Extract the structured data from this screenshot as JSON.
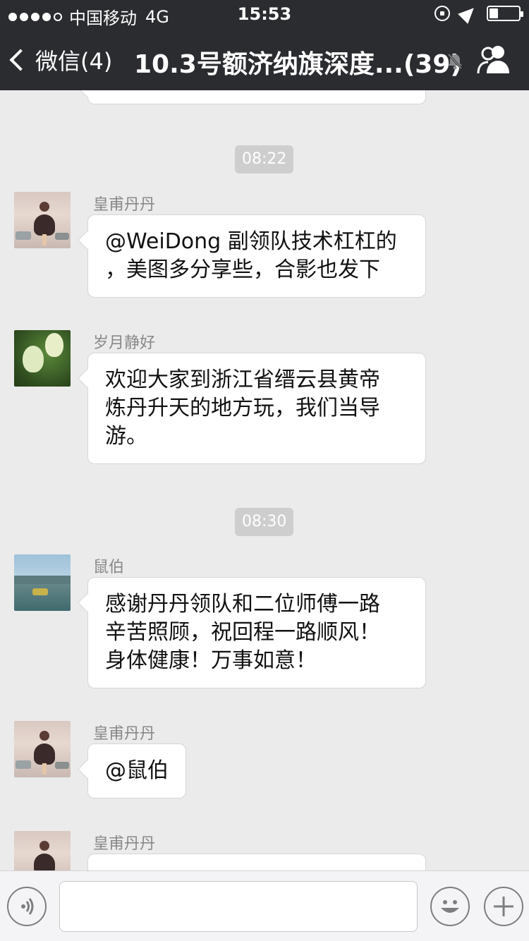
{
  "status_bar": {
    "carrier": "中国移动",
    "network": "4G",
    "time": "15:53"
  },
  "nav": {
    "back_label": "微信(4)",
    "title": "10.3号额济纳旗深度...(39)"
  },
  "messages": [
    {
      "type": "time",
      "text": "08:22"
    },
    {
      "type": "msg",
      "name": "皇甫丹丹",
      "lines": [
        "@WeiDong 副领队技术杠杠的",
        "，美图多分享些，合影也发下"
      ]
    },
    {
      "type": "msg",
      "name": "岁月静好",
      "lines": [
        "欢迎大家到浙江省缙云县黄帝",
        "炼丹升天的地方玩，我们当导",
        "游。"
      ]
    },
    {
      "type": "time",
      "text": "08:30"
    },
    {
      "type": "msg",
      "name": "鼠伯",
      "lines": [
        "感谢丹丹领队和二位师傅一路",
        "辛苦照顾，祝回程一路顺风！",
        "身体健康！万事如意！"
      ]
    },
    {
      "type": "msg",
      "name": "皇甫丹丹",
      "lines": [
        "@鼠伯"
      ]
    },
    {
      "type": "msg",
      "name": "皇甫丹丹",
      "lines": []
    }
  ],
  "icons": {
    "back": "chevron-left-icon",
    "mute": "bell-muted-icon",
    "group": "group-members-icon",
    "voice": "voice-icon",
    "emoji": "emoji-icon",
    "plus": "plus-icon"
  },
  "colors": {
    "nav_bg": "#2b2c30",
    "chat_bg": "#ebebeb",
    "bubble": "#ffffff",
    "time_pill": "#cecece"
  }
}
